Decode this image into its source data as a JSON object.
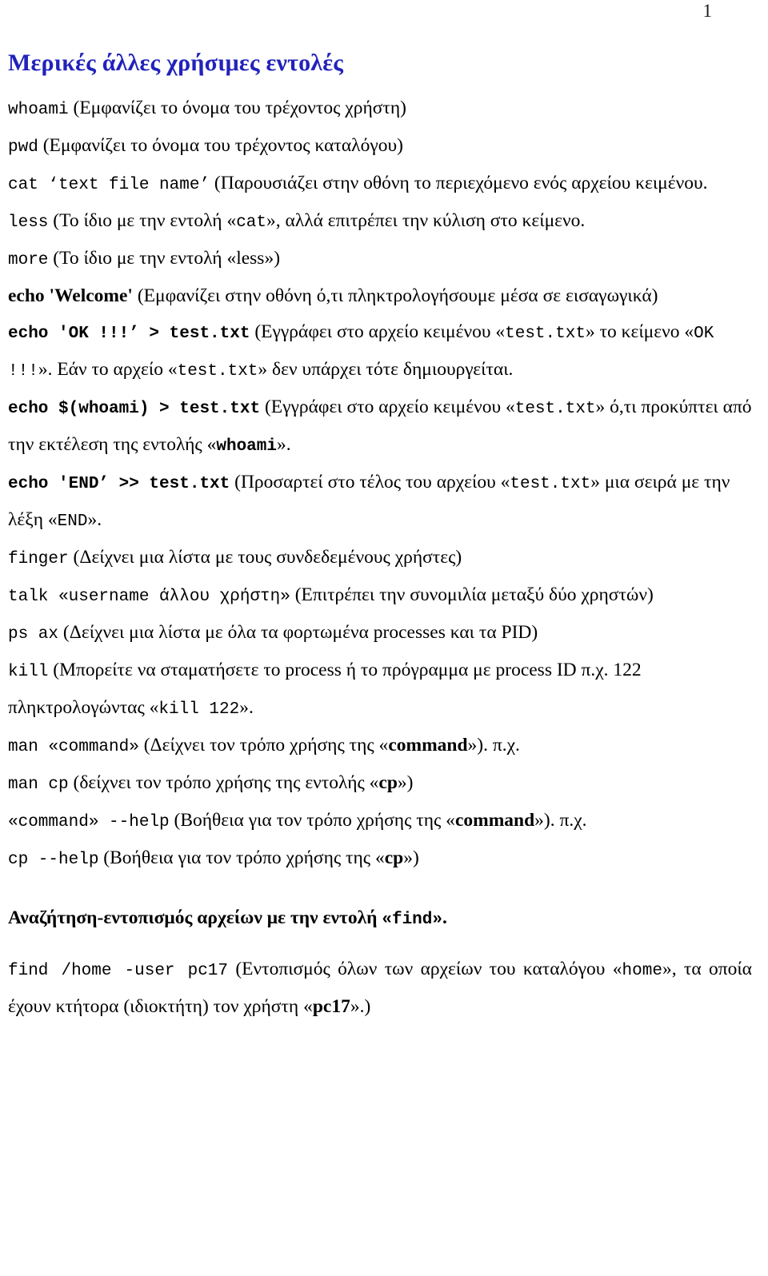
{
  "page": {
    "number": "1",
    "title": "Μερικές άλλες χρήσιμες εντολές",
    "title_color": "#2222bb"
  },
  "entries": [
    {
      "id": "whoami",
      "cmd": "whoami",
      "desc": "(Εμφανίζει το όνομα του τρέχοντος χρήστη)"
    },
    {
      "id": "pwd",
      "cmd": "pwd",
      "desc": "(Εμφανίζει το όνομα του τρέχοντος καταλόγου)"
    },
    {
      "id": "cat",
      "cmd": "cat ‘text file name’",
      "desc": "(Παρουσιάζει στην οθόνη το περιεχόμενο ενός αρχείου κειμένου."
    },
    {
      "id": "less",
      "cmd": "less",
      "desc_a": "(Το ίδιο με την εντολή «",
      "inline_cmd": "cat",
      "desc_b": "», αλλά επιτρέπει την κύλιση στο κείμενο."
    },
    {
      "id": "more",
      "cmd": "more",
      "desc": "(Το ίδιο με την εντολή «less»)"
    },
    {
      "id": "echo-welcome",
      "cmd": "echo 'Welcome'",
      "desc": "(Εμφανίζει στην οθόνη ό,τι πληκτρολογήσουμε μέσα σε εισαγωγικά)"
    },
    {
      "id": "echo-ok",
      "cmd": "echo 'OK !!!’ > test.txt",
      "desc_a": "(Εγγράφει στο αρχείο κειμένου «",
      "file1": "test.txt",
      "desc_b": "» το κείμενο «",
      "literal": "OK !!!",
      "desc_c": "». Εάν το αρχείο «",
      "file2": "test.txt",
      "desc_d": "» δεν υπάρχει τότε δημιουργείται."
    },
    {
      "id": "echo-whoami",
      "cmd": "echo $(whoami) > test.txt",
      "desc_a": "(Εγγράφει στο αρχείο κειμένου «",
      "file1": "test.txt",
      "desc_b": "» ό,τι προκύπτει από την εκτέλεση της εντολής «",
      "inline_cmd": "whoami",
      "desc_c": "»."
    },
    {
      "id": "echo-end",
      "cmd": "echo 'END’ >> test.txt",
      "desc_a": "(Προσαρτεί στο τέλος του αρχείου «",
      "file1": "test.txt",
      "desc_b": "» μια σειρά με την λέξη «",
      "literal": "END",
      "desc_c": "»."
    },
    {
      "id": "finger",
      "cmd": "finger",
      "desc": "(Δείχνει μια λίστα με τους συνδεδεμένους χρήστες)"
    },
    {
      "id": "talk",
      "cmd": "talk «username άλλου χρήστη»",
      "desc": "(Επιτρέπει την συνομιλία μεταξύ δύο χρηστών)"
    },
    {
      "id": "ps-ax",
      "cmd": "ps ax",
      "desc": "(Δείχνει μια λίστα με όλα τα φορτωμένα processes και τα PID)"
    },
    {
      "id": "kill",
      "cmd": "kill",
      "desc_a": "(Μπορείτε να σταματήσετε το process ή το πρόγραμμα με process ID π.χ. 122 πληκτρολογώντας «",
      "inline_cmd": "kill 122",
      "desc_b": "»."
    },
    {
      "id": "man-command",
      "cmd": "man «command»",
      "desc_a": "(Δείχνει τον τρόπο χρήσης της «",
      "bold_term": "command",
      "desc_b": "»). π.χ."
    },
    {
      "id": "man-cp",
      "cmd": "man cp",
      "desc_a": "(δείχνει τον τρόπο χρήσης της εντολής «",
      "bold_term": "cp",
      "desc_b": "»)"
    },
    {
      "id": "command-help",
      "cmd": "«command» --help",
      "desc_a": "(Βοήθεια για τον τρόπο χρήσης της «",
      "bold_term": "command",
      "desc_b": "»). π.χ."
    },
    {
      "id": "cp-help",
      "cmd": "cp --help",
      "desc_a": "(Βοήθεια για τον τρόπο χρήσης της «",
      "bold_term": "cp",
      "desc_b": "»)"
    }
  ],
  "find_section": {
    "heading_text": "Αναζήτηση-εντοπισμός αρχείων με την εντολή ",
    "heading_cmd": "«find»",
    "heading_end": ".",
    "cmd": "find /home -user pc17",
    "desc_a": "(Εντοπισμός όλων των αρχείων του καταλόγου «",
    "dir": "home",
    "desc_b": "», τα οποία έχουν κτήτορα (ιδιοκτήτη) τον χρήστη «",
    "user": "pc17",
    "desc_c": "».)"
  }
}
